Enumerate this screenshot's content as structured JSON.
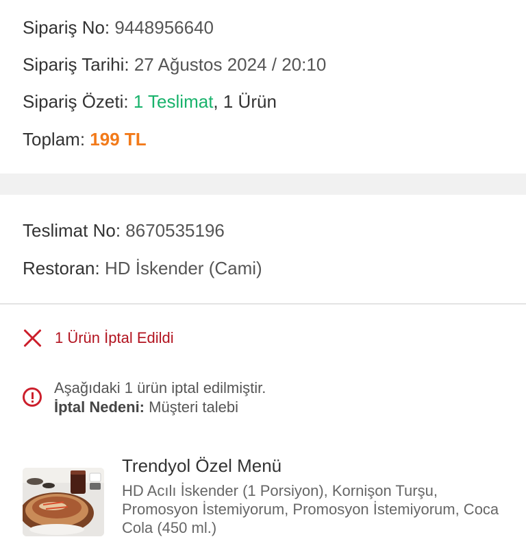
{
  "order": {
    "number_label": "Sipariş No:",
    "number_value": "9448956640",
    "date_label": "Sipariş Tarihi:",
    "date_value": "27 Ağustos 2024 / 20:10",
    "summary_label": "Sipariş Özeti:",
    "summary_deliveries": "1 Teslimat",
    "summary_items": ", 1 Ürün",
    "total_label": "Toplam:",
    "total_value": "199 TL"
  },
  "delivery": {
    "number_label": "Teslimat No:",
    "number_value": "8670535196",
    "restaurant_label": "Restoran:",
    "restaurant_value": "HD İskender (Cami)"
  },
  "cancellation": {
    "status_icon": "close-icon",
    "status_text": "1 Ürün İptal Edildi",
    "info_icon": "info-circle-icon",
    "info_text": "Aşağıdaki 1 ürün iptal edilmiştir.",
    "reason_label": "İptal Nedeni:",
    "reason_value": " Müşteri talebi"
  },
  "product": {
    "title": "Trendyol Özel Menü",
    "description": "HD Acılı İskender (1 Porsiyon), Kornişon Turşu, Promosyon İstemiyorum, Promosyon İstemiyorum, Coca Cola (450 ml.)"
  },
  "colors": {
    "accent_green": "#18b26b",
    "accent_orange": "#f27a1a",
    "cancel_red": "#cc1f2c"
  }
}
